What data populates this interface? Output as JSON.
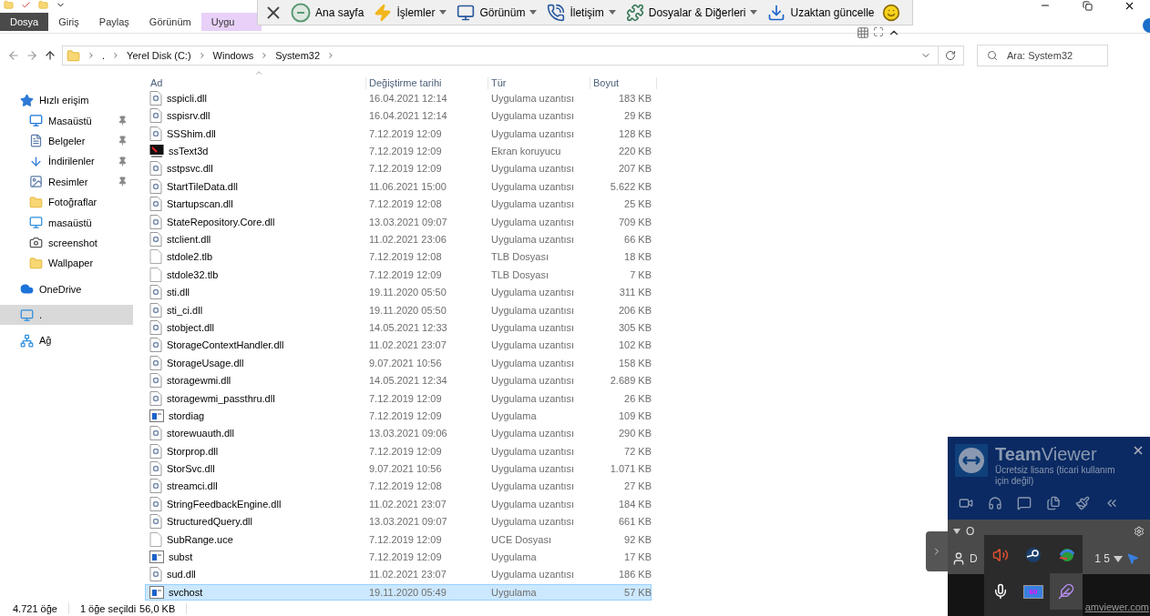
{
  "ribbon": {
    "tabs": [
      {
        "label": "Dosya",
        "kind": "file"
      },
      {
        "label": "Giriş",
        "kind": "tab"
      },
      {
        "label": "Paylaş",
        "kind": "tab"
      },
      {
        "label": "Görünüm",
        "kind": "tab"
      },
      {
        "label": "Uygu",
        "kind": "context"
      }
    ]
  },
  "remote_toolbar": {
    "items": [
      {
        "label": "Ana sayfa",
        "dropdown": false
      },
      {
        "label": "İşlemler",
        "dropdown": true
      },
      {
        "label": "Görünüm",
        "dropdown": true
      },
      {
        "label": "İletişim",
        "dropdown": true
      },
      {
        "label": "Dosyalar & Diğerleri",
        "dropdown": true
      },
      {
        "label": "Uzaktan güncelle",
        "dropdown": false
      }
    ]
  },
  "address": {
    "crumbs": [
      ".",
      "Yerel Disk (C:)",
      "Windows",
      "System32"
    ]
  },
  "search": {
    "placeholder": "Ara: System32"
  },
  "sidebar": {
    "items": [
      {
        "label": "Hızlı erişim",
        "kind": "star",
        "selected": false,
        "children": [
          {
            "label": "Masaüstü",
            "kind": "desktop",
            "pinned": true,
            "selected": false
          },
          {
            "label": "Belgeler",
            "kind": "docs",
            "pinned": true,
            "selected": false
          },
          {
            "label": "İndirilenler",
            "kind": "download",
            "pinned": true,
            "selected": false
          },
          {
            "label": "Resimler",
            "kind": "pictures",
            "pinned": true,
            "selected": false
          },
          {
            "label": "Fotoğraflar",
            "kind": "folder",
            "pinned": false,
            "selected": false
          },
          {
            "label": "masaüstü",
            "kind": "pc",
            "pinned": false,
            "selected": false
          },
          {
            "label": "screenshot",
            "kind": "camera",
            "pinned": false,
            "selected": false
          },
          {
            "label": "Wallpaper",
            "kind": "folder",
            "pinned": false,
            "selected": false
          }
        ]
      },
      {
        "label": "OneDrive",
        "kind": "cloud",
        "selected": false
      },
      {
        "label": ".",
        "kind": "pc",
        "selected": true
      },
      {
        "label": "Ağ",
        "kind": "network",
        "selected": false
      }
    ]
  },
  "table": {
    "columns": [
      "Ad",
      "Değiştirme tarihi",
      "Tür",
      "Boyut"
    ],
    "rows": [
      {
        "name": "sspicli.dll",
        "date": "16.04.2021 12:14",
        "type": "Uygulama uzantısı",
        "size": "183 KB",
        "kind": "dll",
        "selected": false
      },
      {
        "name": "sspisrv.dll",
        "date": "16.04.2021 12:14",
        "type": "Uygulama uzantısı",
        "size": "29 KB",
        "kind": "dll",
        "selected": false
      },
      {
        "name": "SSShim.dll",
        "date": "7.12.2019 12:09",
        "type": "Uygulama uzantısı",
        "size": "128 KB",
        "kind": "dll",
        "selected": false
      },
      {
        "name": "ssText3d",
        "date": "7.12.2019 12:09",
        "type": "Ekran koruyucu",
        "size": "220 KB",
        "kind": "screensaver",
        "selected": false
      },
      {
        "name": "sstpsvc.dll",
        "date": "7.12.2019 12:09",
        "type": "Uygulama uzantısı",
        "size": "207 KB",
        "kind": "dll",
        "selected": false
      },
      {
        "name": "StartTileData.dll",
        "date": "11.06.2021 15:00",
        "type": "Uygulama uzantısı",
        "size": "5.622 KB",
        "kind": "dll",
        "selected": false
      },
      {
        "name": "Startupscan.dll",
        "date": "7.12.2019 12:08",
        "type": "Uygulama uzantısı",
        "size": "25 KB",
        "kind": "dll",
        "selected": false
      },
      {
        "name": "StateRepository.Core.dll",
        "date": "13.03.2021 09:07",
        "type": "Uygulama uzantısı",
        "size": "709 KB",
        "kind": "dll",
        "selected": false
      },
      {
        "name": "stclient.dll",
        "date": "11.02.2021 23:06",
        "type": "Uygulama uzantısı",
        "size": "66 KB",
        "kind": "dll",
        "selected": false
      },
      {
        "name": "stdole2.tlb",
        "date": "7.12.2019 12:08",
        "type": "TLB Dosyası",
        "size": "18 KB",
        "kind": "blank",
        "selected": false
      },
      {
        "name": "stdole32.tlb",
        "date": "7.12.2019 12:09",
        "type": "TLB Dosyası",
        "size": "7 KB",
        "kind": "blank",
        "selected": false
      },
      {
        "name": "sti.dll",
        "date": "19.11.2020 05:50",
        "type": "Uygulama uzantısı",
        "size": "311 KB",
        "kind": "dll",
        "selected": false
      },
      {
        "name": "sti_ci.dll",
        "date": "19.11.2020 05:50",
        "type": "Uygulama uzantısı",
        "size": "206 KB",
        "kind": "dll",
        "selected": false
      },
      {
        "name": "stobject.dll",
        "date": "14.05.2021 12:33",
        "type": "Uygulama uzantısı",
        "size": "305 KB",
        "kind": "dll",
        "selected": false
      },
      {
        "name": "StorageContextHandler.dll",
        "date": "11.02.2021 23:07",
        "type": "Uygulama uzantısı",
        "size": "102 KB",
        "kind": "dll",
        "selected": false
      },
      {
        "name": "StorageUsage.dll",
        "date": "9.07.2021 10:56",
        "type": "Uygulama uzantısı",
        "size": "158 KB",
        "kind": "dll",
        "selected": false
      },
      {
        "name": "storagewmi.dll",
        "date": "14.05.2021 12:34",
        "type": "Uygulama uzantısı",
        "size": "2.689 KB",
        "kind": "dll",
        "selected": false
      },
      {
        "name": "storagewmi_passthru.dll",
        "date": "7.12.2019 12:09",
        "type": "Uygulama uzantısı",
        "size": "26 KB",
        "kind": "dll",
        "selected": false
      },
      {
        "name": "stordiag",
        "date": "7.12.2019 12:09",
        "type": "Uygulama",
        "size": "109 KB",
        "kind": "app",
        "selected": false
      },
      {
        "name": "storewuauth.dll",
        "date": "13.03.2021 09:06",
        "type": "Uygulama uzantısı",
        "size": "290 KB",
        "kind": "dll",
        "selected": false
      },
      {
        "name": "Storprop.dll",
        "date": "7.12.2019 12:09",
        "type": "Uygulama uzantısı",
        "size": "72 KB",
        "kind": "dll",
        "selected": false
      },
      {
        "name": "StorSvc.dll",
        "date": "9.07.2021 10:56",
        "type": "Uygulama uzantısı",
        "size": "1.071 KB",
        "kind": "dll",
        "selected": false
      },
      {
        "name": "streamci.dll",
        "date": "7.12.2019 12:08",
        "type": "Uygulama uzantısı",
        "size": "27 KB",
        "kind": "dll",
        "selected": false
      },
      {
        "name": "StringFeedbackEngine.dll",
        "date": "11.02.2021 23:07",
        "type": "Uygulama uzantısı",
        "size": "184 KB",
        "kind": "dll",
        "selected": false
      },
      {
        "name": "StructuredQuery.dll",
        "date": "13.03.2021 09:07",
        "type": "Uygulama uzantısı",
        "size": "661 KB",
        "kind": "dll",
        "selected": false
      },
      {
        "name": "SubRange.uce",
        "date": "7.12.2019 12:09",
        "type": "UCE Dosyası",
        "size": "92 KB",
        "kind": "blank",
        "selected": false
      },
      {
        "name": "subst",
        "date": "7.12.2019 12:09",
        "type": "Uygulama",
        "size": "17 KB",
        "kind": "app",
        "selected": false
      },
      {
        "name": "sud.dll",
        "date": "11.02.2021 23:07",
        "type": "Uygulama uzantısı",
        "size": "186 KB",
        "kind": "dll",
        "selected": false
      },
      {
        "name": "svchost",
        "date": "19.11.2020 05:49",
        "type": "Uygulama",
        "size": "57 KB",
        "kind": "app",
        "selected": true
      }
    ]
  },
  "status_bar": {
    "count": "4.721 öğe",
    "selection": "1 öğe seçildi",
    "size": "56,0 KB"
  },
  "teamviewer": {
    "title_bold": "Team",
    "title_rest": "Viewer",
    "subtitle": "Ücretsiz lisans (ticari kullanım için değil)",
    "group": "O",
    "contact": "D",
    "contact_tail": "1 5",
    "footer": "amviewer.com"
  },
  "tray": {
    "items": [
      {
        "kind": "speaker",
        "selected": false
      },
      {
        "kind": "steam",
        "selected": false
      },
      {
        "kind": "globe",
        "selected": false
      },
      {
        "kind": "mic",
        "selected": false
      },
      {
        "kind": "monitor",
        "text": "60",
        "selected": false
      },
      {
        "kind": "feather",
        "selected": true
      }
    ]
  }
}
